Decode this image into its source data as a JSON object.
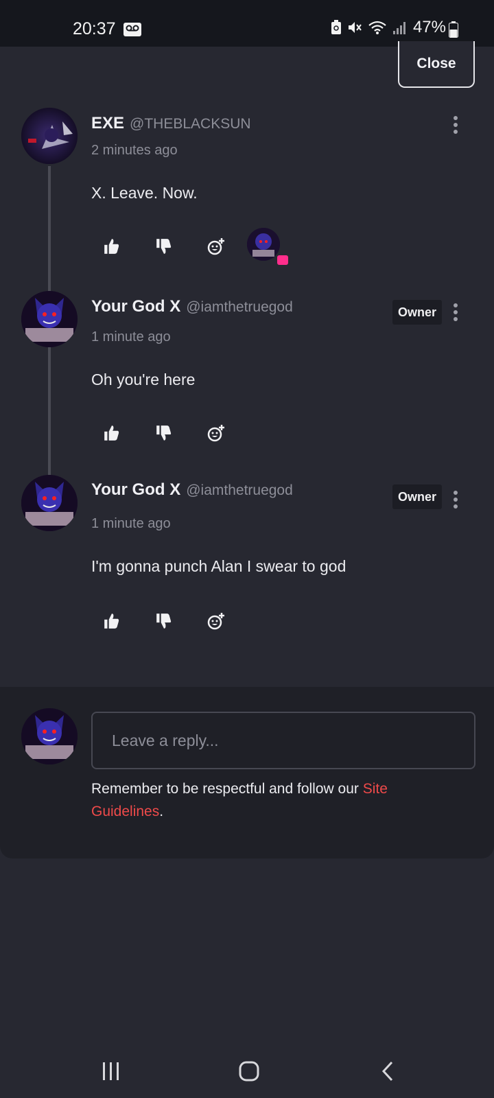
{
  "status_bar": {
    "time": "20:37",
    "battery": "47%",
    "icons": [
      "voicemail-icon",
      "battery-saver-icon",
      "mute-icon",
      "wifi-icon",
      "signal-icon",
      "battery-icon"
    ]
  },
  "header": {
    "close_label": "Close"
  },
  "comments": [
    {
      "name": "EXE",
      "handle": "@THEBLACKSUN",
      "time": "2 minutes ago",
      "body": "X. Leave. Now.",
      "badge": "",
      "has_reply_avatar": true
    },
    {
      "name": "Your God X",
      "handle": "@iamthetruegod",
      "time": "1 minute ago",
      "body": "Oh you're here",
      "badge": "Owner"
    },
    {
      "name": "Your God X",
      "handle": "@iamthetruegod",
      "time": "1 minute ago",
      "body": "I'm gonna punch Alan I swear to god",
      "badge": "Owner"
    }
  ],
  "reply": {
    "placeholder": "Leave a reply...",
    "note_prefix": "Remember to be respectful and follow our ",
    "note_link": "Site Guidelines",
    "note_suffix": "."
  },
  "colors": {
    "background": "#272831",
    "panel": "#1f2027",
    "link": "#ef4a4a",
    "notification": "#ff2e8c"
  }
}
